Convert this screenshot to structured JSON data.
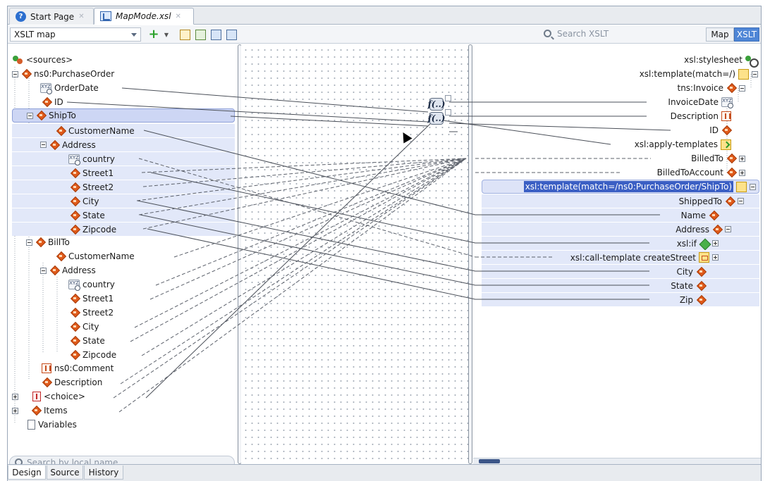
{
  "tabs": [
    {
      "label": "Start Page",
      "icon": "help-icon"
    },
    {
      "label": "MapMode.xsl",
      "icon": "xslt-map-icon"
    }
  ],
  "toolbar": {
    "view_combo": "XSLT map",
    "search_placeholder": "Search XSLT",
    "map_button": "Map",
    "xslt_button": "XSLT"
  },
  "source_tree": {
    "root": "<sources>",
    "nodes": [
      {
        "label": "ns0:PurchaseOrder",
        "icon": "element-icon"
      },
      {
        "label": "OrderDate",
        "icon": "attribute-icon"
      },
      {
        "label": "ID",
        "icon": "element-icon"
      },
      {
        "label": "ShipTo",
        "icon": "element-icon"
      },
      {
        "label": "CustomerName",
        "icon": "element-icon"
      },
      {
        "label": "Address",
        "icon": "element-icon"
      },
      {
        "label": "country",
        "icon": "attribute-icon"
      },
      {
        "label": "Street1",
        "icon": "element-icon"
      },
      {
        "label": "Street2",
        "icon": "element-icon"
      },
      {
        "label": "City",
        "icon": "element-icon"
      },
      {
        "label": "State",
        "icon": "element-icon"
      },
      {
        "label": "Zipcode",
        "icon": "element-icon"
      },
      {
        "label": "BillTo",
        "icon": "element-icon"
      },
      {
        "label": "CustomerName",
        "icon": "element-icon"
      },
      {
        "label": "Address",
        "icon": "element-icon"
      },
      {
        "label": "country",
        "icon": "attribute-icon"
      },
      {
        "label": "Street1",
        "icon": "element-icon"
      },
      {
        "label": "Street2",
        "icon": "element-icon"
      },
      {
        "label": "City",
        "icon": "element-icon"
      },
      {
        "label": "State",
        "icon": "element-icon"
      },
      {
        "label": "Zipcode",
        "icon": "element-icon"
      },
      {
        "label": "ns0:Comment",
        "icon": "sequence-icon"
      },
      {
        "label": "Description",
        "icon": "element-icon"
      },
      {
        "label": "<choice>",
        "icon": "choice-icon"
      },
      {
        "label": "Items",
        "icon": "element-icon"
      },
      {
        "label": "Variables",
        "icon": "document-icon"
      }
    ],
    "search_placeholder": "Search by local name"
  },
  "target_tree": {
    "nodes": [
      {
        "label": "xsl:stylesheet"
      },
      {
        "label": "xsl:template(match=/)"
      },
      {
        "label": "tns:Invoice"
      },
      {
        "label": "InvoiceDate"
      },
      {
        "label": "Description"
      },
      {
        "label": "ID"
      },
      {
        "label": "xsl:apply-templates"
      },
      {
        "label": "BilledTo"
      },
      {
        "label": "BilledToAccount"
      },
      {
        "label": "xsl:template(match=/ns0:PurchaseOrder/ShipTo)"
      },
      {
        "label": "ShippedTo"
      },
      {
        "label": "Name"
      },
      {
        "label": "Address"
      },
      {
        "label": "xsl:if"
      },
      {
        "label": "xsl:call-template createStreet"
      },
      {
        "label": "City"
      },
      {
        "label": "State"
      },
      {
        "label": "Zip"
      }
    ]
  },
  "functions": [
    {
      "label": "f(..)"
    },
    {
      "label": "f(..)"
    }
  ],
  "bottom_tabs": [
    "Design",
    "Source",
    "History"
  ],
  "colors": {
    "accent": "#4f86d6",
    "selection": "#3b5fc4",
    "highlight_row": "#e2e8f9",
    "element_icon": "#e05a1a"
  }
}
